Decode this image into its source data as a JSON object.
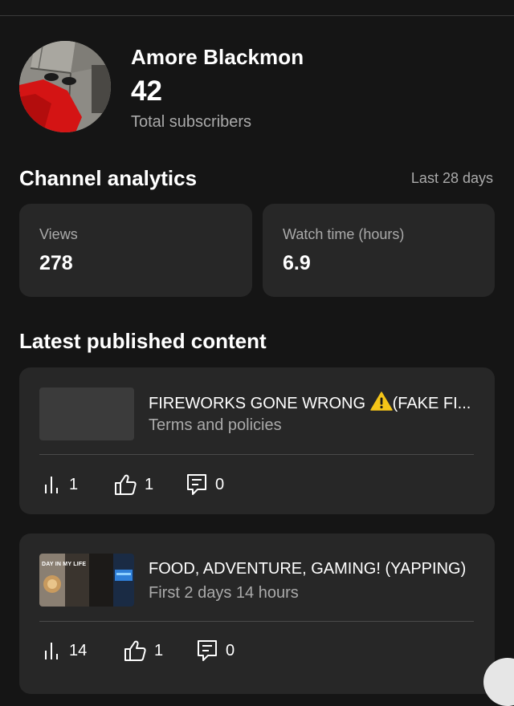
{
  "channel": {
    "name": "Amore Blackmon",
    "subscribers": "42",
    "subscribers_label": "Total subscribers"
  },
  "analytics": {
    "title": "Channel analytics",
    "period": "Last 28 days",
    "views_label": "Views",
    "views_value": "278",
    "watch_label": "Watch time (hours)",
    "watch_value": "6.9"
  },
  "latest": {
    "title": "Latest published content",
    "videos": [
      {
        "title": "FIREWORKS GONE WRONG",
        "title_suffix": "(FAKE FI...",
        "subtitle": "Terms and policies",
        "views": "1",
        "likes": "1",
        "comments": "0"
      },
      {
        "title": "FOOD, ADVENTURE, GAMING! (YAPPING)",
        "subtitle": "First 2 days 14 hours",
        "thumb_text": "DAY IN MY LIFE",
        "views": "14",
        "likes": "1",
        "comments": "0"
      }
    ]
  },
  "colors": {
    "background": "#151515",
    "card": "#272727",
    "muted_text": "#aaaaaa",
    "warning": "#f5c518"
  },
  "icons": [
    "warning-icon",
    "bar-chart-icon",
    "thumbs-up-icon",
    "comment-icon"
  ]
}
